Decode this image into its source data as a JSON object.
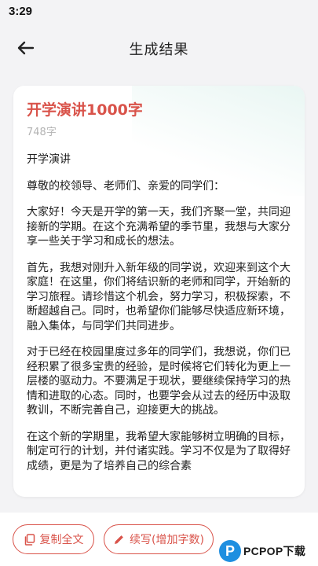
{
  "status_bar": {
    "time": "3:29"
  },
  "header": {
    "title": "生成结果",
    "back_icon": "arrow-left-icon"
  },
  "document": {
    "title": "开学演讲1000字",
    "word_count": "748字",
    "paragraphs": [
      "开学演讲",
      "尊敬的校领导、老师们、亲爱的同学们：",
      "大家好！今天是开学的第一天，我们齐聚一堂，共同迎接新的学期。在这个充满希望的季节里，我想与大家分享一些关于学习和成长的想法。",
      "首先，我想对刚升入新年级的同学说，欢迎来到这个大家庭！在这里，你们将结识新的老师和同学，开始新的学习旅程。请珍惜这个机会，努力学习，积极探索，不断超越自己。同时，也希望你们能够尽快适应新环境，融入集体，与同学们共同进步。",
      "对于已经在校园里度过多年的同学们，我想说，你们已经积累了很多宝贵的经验，是时候将它们转化为更上一层楼的驱动力。不要满足于现状，要继续保持学习的热情和进取的心态。同时，也要学会从过去的经历中汲取教训，不断完善自己，迎接更大的挑战。",
      "在这个新的学期里，我希望大家能够树立明确的目标，制定可行的计划，并付诸实践。学习不仅是为了取得好成绩，更是为了培养自己的综合素"
    ]
  },
  "actions": {
    "copy_label": "复制全文",
    "continue_label": "续写(增加字数)",
    "copy_icon": "copy-icon",
    "continue_icon": "pencil-icon",
    "accent_color": "#d9534a"
  },
  "watermark": {
    "logo_letter": "P",
    "text": "PCPOP下载"
  }
}
